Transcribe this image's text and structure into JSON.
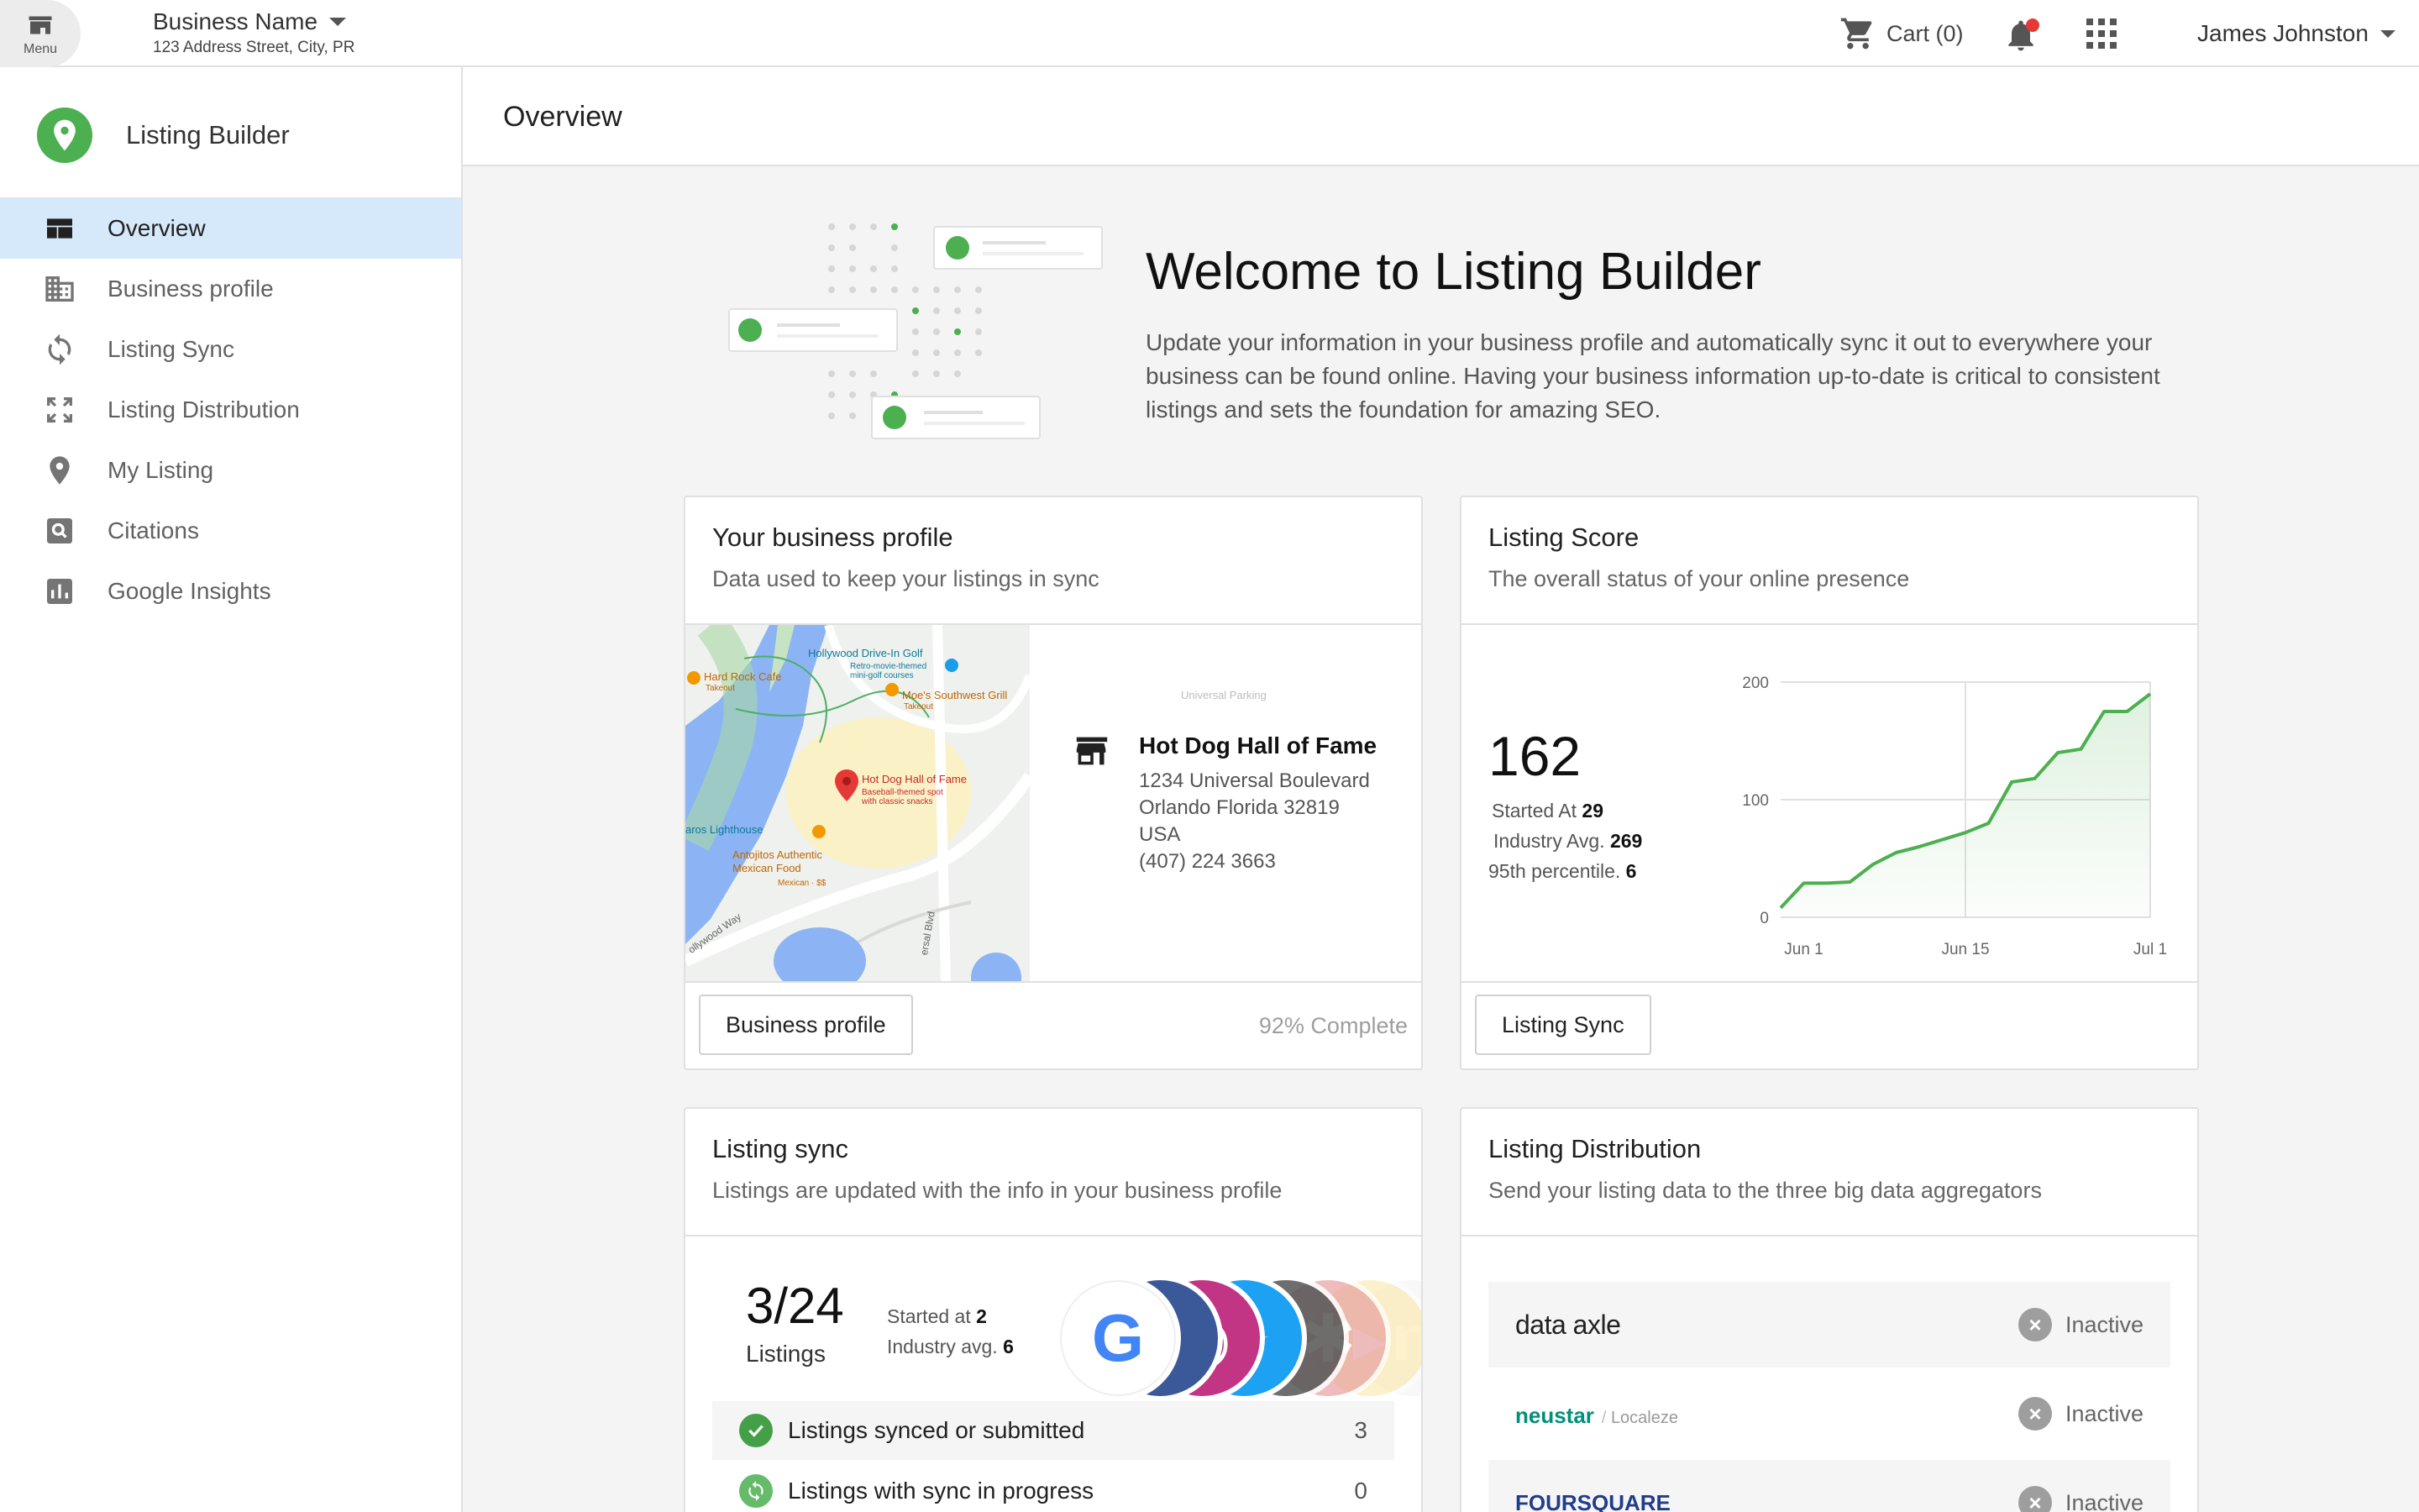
{
  "topbar": {
    "menu_label": "Menu",
    "business_name": "Business Name",
    "business_address": "123 Address Street, City, PR",
    "cart_label": "Cart (0)",
    "user_name": "James Johnston"
  },
  "sidebar": {
    "app_title": "Listing Builder",
    "items": [
      {
        "label": "Overview",
        "icon": "dashboard-icon",
        "active": true
      },
      {
        "label": "Business profile",
        "icon": "building-icon",
        "active": false
      },
      {
        "label": "Listing Sync",
        "icon": "sync-icon",
        "active": false
      },
      {
        "label": "Listing Distribution",
        "icon": "expand-icon",
        "active": false
      },
      {
        "label": "My Listing",
        "icon": "pin-icon",
        "active": false
      },
      {
        "label": "Citations",
        "icon": "search-box-icon",
        "active": false
      },
      {
        "label": "Google Insights",
        "icon": "bar-chart-icon",
        "active": false
      }
    ]
  },
  "main": {
    "page_title": "Overview",
    "welcome_title": "Welcome to Listing Builder",
    "welcome_text": "Update your information in your business profile and automatically sync it out to everywhere your business can be found online. Having your business information up-to-date is critical to consistent listings and sets the foundation for amazing SEO."
  },
  "business_profile_card": {
    "title": "Your business profile",
    "subtitle": "Data used to keep your listings in sync",
    "place_name": "Hot Dog Hall of Fame",
    "address_line1": "1234 Universal Boulevard",
    "address_line2": "Orlando Florida 32819",
    "country": "USA",
    "phone": "(407) 224 3663",
    "map_labels": {
      "drive_in": "Hollywood Drive-In Golf",
      "drive_in_sub": "Retro-movie-themed mini-golf courses",
      "hard_rock": "Hard Rock Cafe",
      "hard_rock_sub": "Takeout",
      "moes": "Moe's Southwest Grill",
      "moes_sub": "Takeout",
      "hotdog": "Hot Dog Hall of Fame",
      "hotdog_sub": "Baseball-themed spot with classic snacks",
      "lighthouse": "aros Lighthouse",
      "antojitos": "Antojitos Authentic Mexican Food",
      "antojitos_sub": "Mexican · $$",
      "hollywood_way": "ollywood Way",
      "universal_blvd": "ersal Blvd",
      "universal_parking": "Universal Parking"
    },
    "button_label": "Business profile",
    "completion": "92% Complete"
  },
  "listing_score_card": {
    "title": "Listing Score",
    "subtitle": "The overall status of your online presence",
    "score": "162",
    "started_label": "Started At",
    "started_value": "29",
    "industry_label": "Industry Avg.",
    "industry_value": "269",
    "percentile_label": "95th percentile.",
    "percentile_value": "6",
    "button_label": "Listing Sync"
  },
  "chart_data": {
    "type": "area",
    "x": [
      "May 31",
      "Jun 1",
      "Jun 3",
      "Jun 5",
      "Jun 7",
      "Jun 9",
      "Jun 11",
      "Jun 13",
      "Jun 15",
      "Jun 17",
      "Jun 19",
      "Jun 21",
      "Jun 23",
      "Jun 25",
      "Jun 27",
      "Jun 29",
      "Jul 1"
    ],
    "values": [
      8,
      29,
      29,
      30,
      45,
      55,
      60,
      66,
      72,
      80,
      115,
      118,
      140,
      143,
      175,
      175,
      190
    ],
    "xticks": [
      "Jun 1",
      "Jun 15",
      "Jul 1"
    ],
    "yticks": [
      "0",
      "100",
      "200"
    ],
    "ylim": [
      0,
      200
    ],
    "color": "#4caf50",
    "grid": true,
    "vline_at": "Jun 15"
  },
  "listing_sync_card": {
    "title": "Listing sync",
    "subtitle": "Listings are updated with the info in your business profile",
    "count": "3/24",
    "count_label": "Listings",
    "started_label": "Started at",
    "started_value": "2",
    "industry_label": "Industry avg.",
    "industry_value": "6",
    "logos": [
      {
        "name": "google-logo",
        "glyph": "G",
        "color": "#ffffff",
        "text": "#4285f4"
      },
      {
        "name": "facebook-logo",
        "glyph": "f",
        "color": "#3b5998",
        "text": "#ffffff"
      },
      {
        "name": "instagram-logo",
        "glyph": "◎",
        "color": "#c13584",
        "text": "#ffffff"
      },
      {
        "name": "twitter-logo",
        "glyph": "✦",
        "color": "#1da1f2",
        "text": "#ffffff"
      },
      {
        "name": "apple-logo",
        "glyph": "",
        "color": "#555555",
        "text": "#ffffff"
      },
      {
        "name": "yelp-logo",
        "glyph": "✱",
        "color": "#e8a0a0",
        "text": "#ffffff"
      },
      {
        "name": "bing-logo",
        "glyph": "▸",
        "color": "#fbe7a1",
        "text": "#ffffff"
      },
      {
        "name": "other-logo",
        "glyph": "n",
        "color": "#eeeeee",
        "text": "#ffffff"
      }
    ],
    "rows": [
      {
        "label": "Listings synced or submitted",
        "count": "3",
        "icon": "check-circle-icon"
      },
      {
        "label": "Listings with sync in progress",
        "count": "0",
        "icon": "sync-circle-icon"
      }
    ]
  },
  "listing_distribution_card": {
    "title": "Listing Distribution",
    "subtitle": "Send your listing data to the three big data aggregators",
    "rows": [
      {
        "logo": "data axle",
        "status": "Inactive"
      },
      {
        "logo": "neustar",
        "logo_sub": "Localeze",
        "status": "Inactive"
      },
      {
        "logo": "FOURSQUARE",
        "status": "Inactive"
      }
    ]
  }
}
